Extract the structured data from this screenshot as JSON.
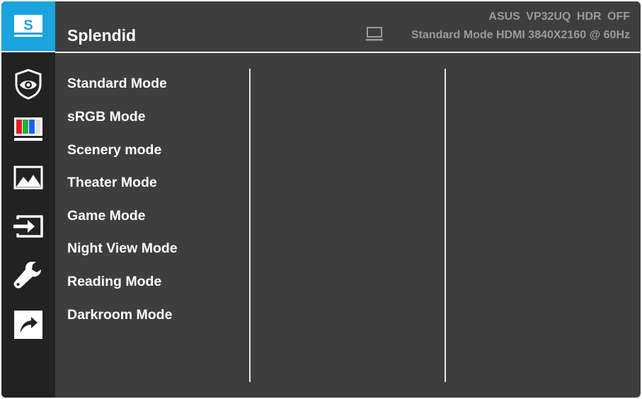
{
  "header": {
    "title": "Splendid",
    "brand": "ASUS",
    "model": "VP32UQ",
    "hdr": "HDR OFF",
    "status": "Standard Mode HDMI 3840X2160 @ 60Hz"
  },
  "sidebar": {
    "items": [
      {
        "name": "splendid",
        "icon": "s-logo-icon",
        "label": "S",
        "active": true
      },
      {
        "name": "blue-light-filter",
        "icon": "eye-icon"
      },
      {
        "name": "color",
        "icon": "color-bars-icon"
      },
      {
        "name": "image",
        "icon": "image-icon"
      },
      {
        "name": "input-select",
        "icon": "input-icon"
      },
      {
        "name": "system-setup",
        "icon": "wrench-icon"
      },
      {
        "name": "shortcut",
        "icon": "shortcut-arrow-icon"
      }
    ]
  },
  "menu": {
    "items": [
      "Standard Mode",
      "sRGB Mode",
      "Scenery mode",
      "Theater Mode",
      "Game Mode",
      "Night View Mode",
      "Reading Mode",
      "Darkroom Mode"
    ]
  },
  "colors": {
    "accent": "#1aa3df",
    "background": "#3e3e3e",
    "sidebar": "#222222",
    "text": "#ffffff",
    "muted": "#9a9a9a"
  }
}
